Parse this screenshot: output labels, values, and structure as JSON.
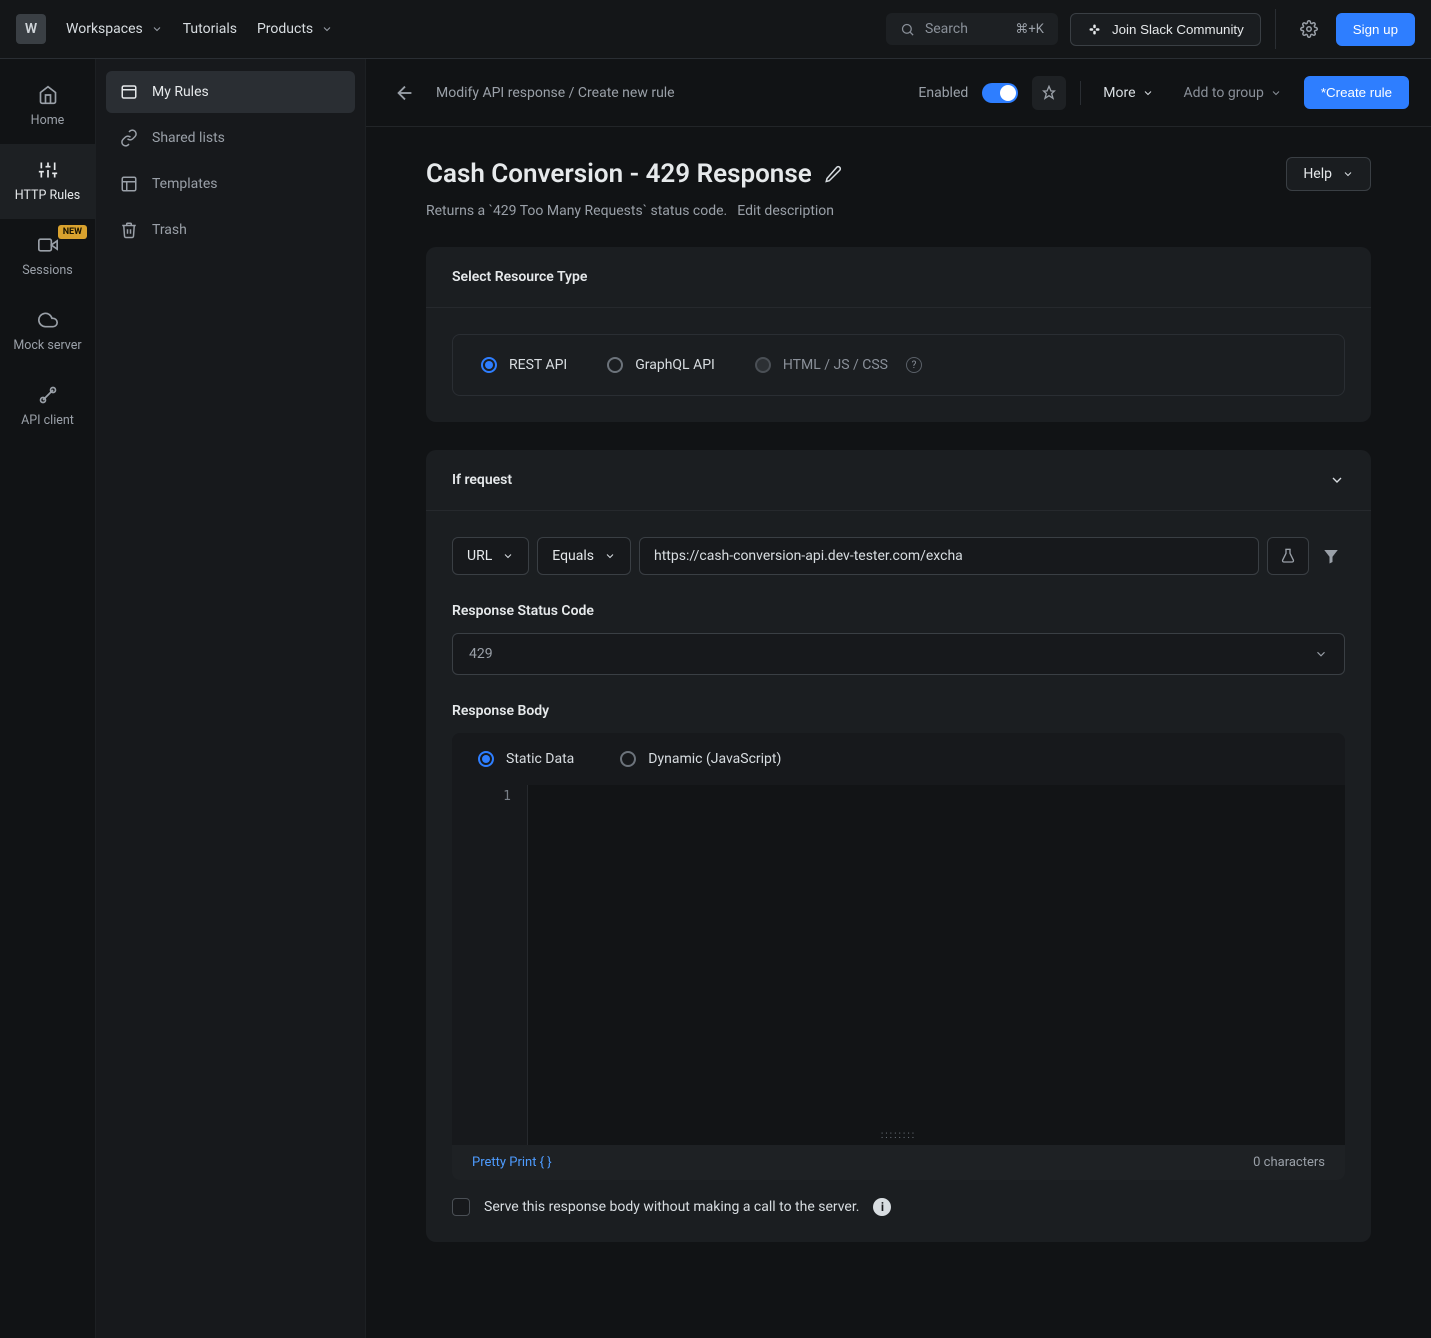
{
  "topbar": {
    "workspace_initial": "W",
    "workspaces": "Workspaces",
    "tutorials": "Tutorials",
    "products": "Products",
    "search_placeholder": "Search",
    "search_kbd": "⌘+K",
    "slack": "Join Slack Community",
    "signup": "Sign up"
  },
  "rail": {
    "home": "Home",
    "http_rules": "HTTP Rules",
    "sessions": "Sessions",
    "sessions_badge": "NEW",
    "mock_server": "Mock server",
    "api_client": "API client"
  },
  "sidebar": {
    "my_rules": "My Rules",
    "shared_lists": "Shared lists",
    "templates": "Templates",
    "trash": "Trash"
  },
  "crumb": {
    "text": "Modify API response / Create new rule",
    "enabled": "Enabled",
    "more": "More",
    "add_group": "Add to group",
    "create": "*Create rule"
  },
  "header": {
    "title": "Cash Conversion - 429 Response",
    "help": "Help",
    "desc": "Returns a `429 Too Many Requests` status code.",
    "edit_desc": "Edit description"
  },
  "resource": {
    "section": "Select Resource Type",
    "rest": "REST API",
    "graphql": "GraphQL API",
    "html": "HTML / JS / CSS"
  },
  "request": {
    "section": "If request",
    "url_label": "URL",
    "match_label": "Equals",
    "url_value": "https://cash-conversion-api.dev-tester.com/excha",
    "status_label": "Response Status Code",
    "status_value": "429",
    "body_label": "Response Body",
    "static": "Static Data",
    "dynamic": "Dynamic (JavaScript)",
    "line_no": "1",
    "pretty": "Pretty Print { }",
    "char_count": "0 characters",
    "serve": "Serve this response body without making a call to the server."
  }
}
